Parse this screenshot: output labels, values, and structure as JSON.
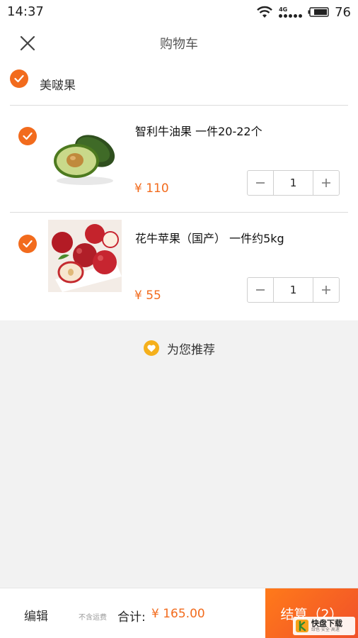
{
  "status_bar": {
    "time": "14:37",
    "network": "4G",
    "battery": "76"
  },
  "header": {
    "title": "购物车"
  },
  "store": {
    "name": "美啵果"
  },
  "items": [
    {
      "name": "智利牛油果  一件20-22个",
      "price": "¥ 110",
      "quantity": "1",
      "image": "avocado"
    },
    {
      "name": "花牛苹果（国产）  一件约5kg",
      "price": "¥ 55",
      "quantity": "1",
      "image": "red-apples"
    }
  ],
  "recommend": {
    "label": "为您推荐"
  },
  "bottom_bar": {
    "edit_label": "编辑",
    "shipping_note": "不含运费",
    "total_label": "合计:",
    "total_value": "¥ 165.00",
    "checkout_label": "结算（2）"
  },
  "watermark": {
    "text": "快盘下载",
    "sub": "绿色·安全·高速"
  },
  "colors": {
    "accent": "#f26b1d",
    "recommend_icon": "#f5b01c"
  }
}
